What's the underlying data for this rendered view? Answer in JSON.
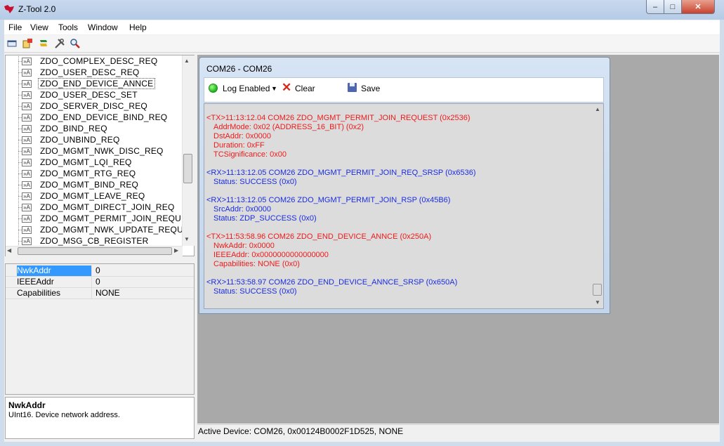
{
  "app": {
    "title": "Z-Tool 2.0"
  },
  "window_controls": {
    "minimize": "–",
    "maximize": "□",
    "close": "✕"
  },
  "menu": [
    "File",
    "View",
    "Tools",
    "Window",
    "Help"
  ],
  "toolbar_icons": [
    "console-icon",
    "device-icon",
    "script-icon",
    "tools-icon",
    "search-icon"
  ],
  "tree": {
    "items": [
      "ZDO_COMPLEX_DESC_REQ",
      "ZDO_USER_DESC_REQ",
      "ZDO_END_DEVICE_ANNCE",
      "ZDO_USER_DESC_SET",
      "ZDO_SERVER_DISC_REQ",
      "ZDO_END_DEVICE_BIND_REQ",
      "ZDO_BIND_REQ",
      "ZDO_UNBIND_REQ",
      "ZDO_MGMT_NWK_DISC_REQ",
      "ZDO_MGMT_LQI_REQ",
      "ZDO_MGMT_RTG_REQ",
      "ZDO_MGMT_BIND_REQ",
      "ZDO_MGMT_LEAVE_REQ",
      "ZDO_MGMT_DIRECT_JOIN_REQ",
      "ZDO_MGMT_PERMIT_JOIN_REQUES",
      "ZDO_MGMT_NWK_UPDATE_REQUE",
      "ZDO_MSG_CB_REGISTER"
    ],
    "selected": "ZDO_END_DEVICE_ANNCE",
    "node_glyph": "»A"
  },
  "properties": [
    {
      "name": "NwkAddr",
      "value": "0"
    },
    {
      "name": "IEEEAddr",
      "value": "0"
    },
    {
      "name": "Capabilities",
      "value": "NONE"
    }
  ],
  "description": {
    "title": "NwkAddr",
    "text": "UInt16.  Device network address."
  },
  "child_window": {
    "title": "COM26 - COM26",
    "log_enabled_label": "Log Enabled",
    "clear_label": "Clear",
    "save_label": "Save"
  },
  "log": [
    {
      "dir": "tx",
      "header": "<TX>11:13:12.04 COM26 ZDO_MGMT_PERMIT_JOIN_REQUEST (0x2536)",
      "fields": [
        "AddrMode: 0x02 (ADDRESS_16_BIT) (0x2)",
        "DstAddr: 0x0000",
        "Duration: 0xFF",
        "TCSignificance: 0x00"
      ]
    },
    {
      "dir": "rx",
      "header": "<RX>11:13:12.05 COM26 ZDO_MGMT_PERMIT_JOIN_REQ_SRSP (0x6536)",
      "fields": [
        "Status: SUCCESS (0x0)"
      ]
    },
    {
      "dir": "rx",
      "header": "<RX>11:13:12.05 COM26 ZDO_MGMT_PERMIT_JOIN_RSP (0x45B6)",
      "fields": [
        "SrcAddr: 0x0000",
        "Status: ZDP_SUCCESS (0x0)"
      ]
    },
    {
      "dir": "tx",
      "header": "<TX>11:53:58.96 COM26 ZDO_END_DEVICE_ANNCE (0x250A)",
      "fields": [
        "NwkAddr: 0x0000",
        "IEEEAddr: 0x0000000000000000",
        "Capabilities: NONE (0x0)"
      ]
    },
    {
      "dir": "rx",
      "header": "<RX>11:53:58.97 COM26 ZDO_END_DEVICE_ANNCE_SRSP (0x650A)",
      "fields": [
        "Status: SUCCESS (0x0)"
      ]
    }
  ],
  "status": {
    "text": "Active Device: COM26, 0x00124B0002F1D525, NONE"
  },
  "colors": {
    "tx": "#f01a1a",
    "rx": "#1a2ce0",
    "selection": "#3399ff",
    "mdi_background": "#a9a9a9"
  }
}
